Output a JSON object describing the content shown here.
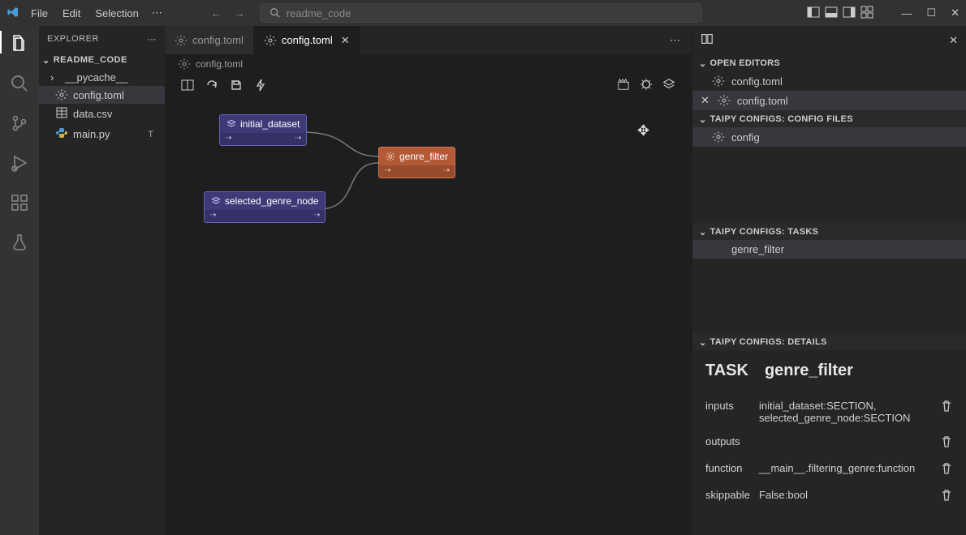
{
  "title_menu": {
    "file": "File",
    "edit": "Edit",
    "selection": "Selection"
  },
  "search_placeholder": "readme_code",
  "explorer_label": "EXPLORER",
  "project_name": "README_CODE",
  "files": {
    "pycache": "__pycache__",
    "config": "config.toml",
    "data": "data.csv",
    "main": "main.py",
    "main_mod": "T"
  },
  "tabs": {
    "t1": "config.toml",
    "t2": "config.toml"
  },
  "breadcrumb": "config.toml",
  "nodes": {
    "n1": "initial_dataset",
    "n2": "selected_genre_node",
    "n3": "genre_filter"
  },
  "right": {
    "open_editors": "OPEN EDITORS",
    "open_items": {
      "a": "config.toml",
      "b": "config.toml"
    },
    "config_files": "TAIPY CONFIGS: CONFIG FILES",
    "config_item": "config",
    "tasks": "TAIPY CONFIGS: TASKS",
    "task_item": "genre_filter",
    "details": "TAIPY CONFIGS: DETAILS",
    "detail_kind": "TASK",
    "detail_name": "genre_filter",
    "inputs_k": "inputs",
    "inputs_v": "initial_dataset:SECTION, selected_genre_node:SECTION",
    "outputs_k": "outputs",
    "outputs_v": "",
    "function_k": "function",
    "function_v": "__main__.filtering_genre:function",
    "skippable_k": "skippable",
    "skippable_v": "False:bool"
  }
}
